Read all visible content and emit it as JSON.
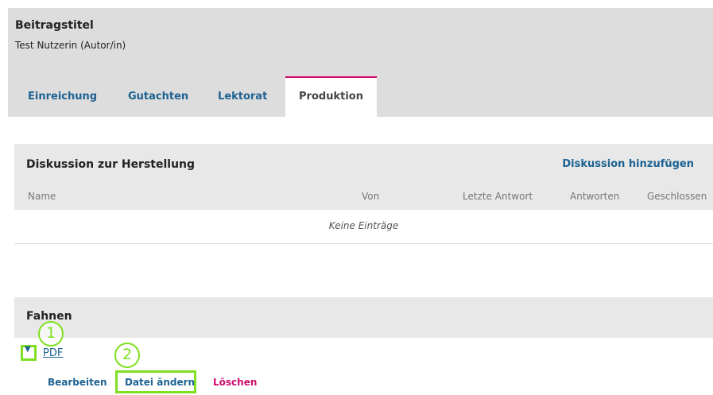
{
  "header": {
    "title": "Beitragstitel",
    "subtitle": "Test Nutzerin (Autor/in)"
  },
  "tabs": [
    {
      "label": "Einreichung"
    },
    {
      "label": "Gutachten"
    },
    {
      "label": "Lektorat"
    },
    {
      "label": "Produktion",
      "active": true
    }
  ],
  "discussion": {
    "heading": "Diskussion zur Herstellung",
    "add_label": "Diskussion hinzufügen",
    "columns": [
      "Name",
      "Von",
      "Letzte Antwort",
      "Antworten",
      "Geschlossen"
    ],
    "empty_text": "Keine Einträge"
  },
  "galleys": {
    "heading": "Fahnen",
    "toggle_icon": "triangle-down-icon",
    "file_label": "PDF",
    "actions": {
      "edit": "Bearbeiten",
      "change_file": "Datei ändern",
      "delete": "Löschen"
    }
  },
  "callouts": [
    "1",
    "2"
  ],
  "colors": {
    "header_bg": "#dddddd",
    "link": "#1e6292",
    "accent": "#d00a6c",
    "highlight": "#7fe021"
  }
}
